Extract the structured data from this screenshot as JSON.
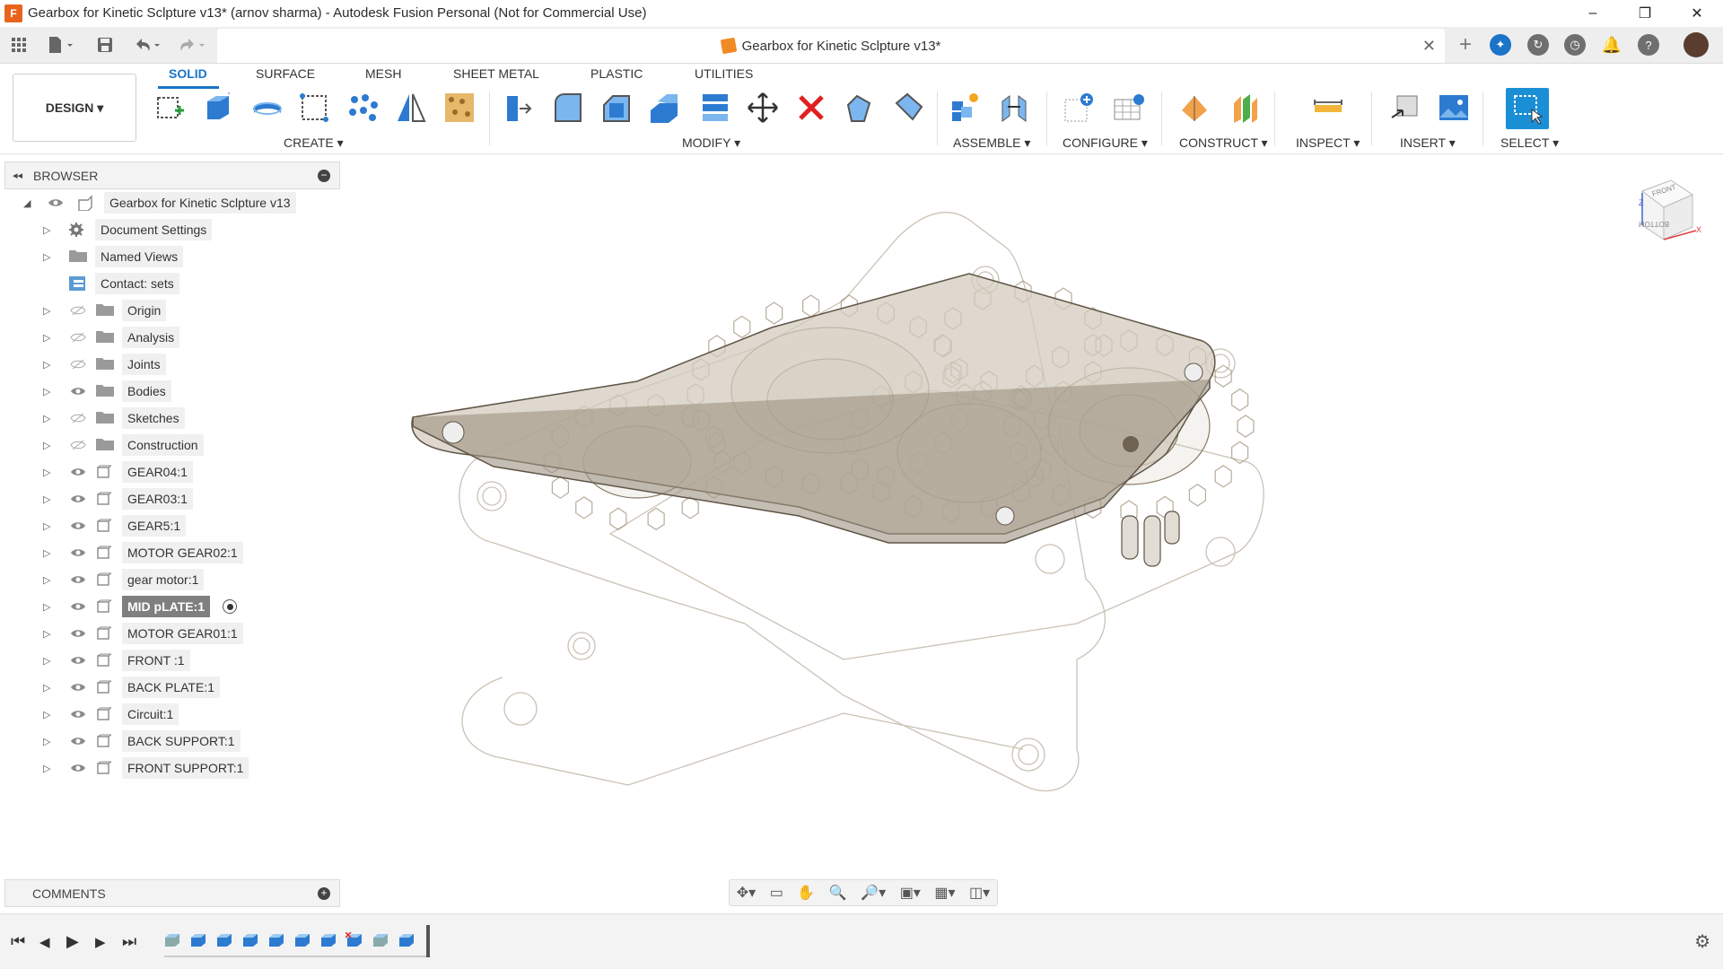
{
  "titlebar": {
    "text": "Gearbox for Kinetic Sclpture v13* (arnov sharma) - Autodesk Fusion Personal (Not for Commercial Use)",
    "app_icon": "F",
    "minimize": "–",
    "restore": "❐",
    "close": "✕"
  },
  "doc_tab": {
    "title": "Gearbox for Kinetic Sclpture v13*",
    "close": "✕"
  },
  "design_button": "DESIGN ▾",
  "tabs": [
    "SOLID",
    "SURFACE",
    "MESH",
    "SHEET METAL",
    "PLASTIC",
    "UTILITIES"
  ],
  "groups": [
    "CREATE ▾",
    "MODIFY ▾",
    "ASSEMBLE ▾",
    "CONFIGURE ▾",
    "CONSTRUCT ▾",
    "INSPECT ▾",
    "INSERT ▾",
    "SELECT ▾"
  ],
  "browser": {
    "title": "BROWSER",
    "collapse": "◂◂",
    "minus": "−"
  },
  "tree": [
    {
      "label": "Gearbox for Kinetic Sclpture v13",
      "icon": "document-icon"
    },
    {
      "label": "Document Settings",
      "icon": "gear-icon"
    },
    {
      "label": "Named Views",
      "icon": "folder-icon"
    },
    {
      "label": "Contact: sets",
      "icon": "contact-sets-icon"
    },
    {
      "label": "Origin",
      "icon": "folder-icon"
    },
    {
      "label": "Analysis",
      "icon": "folder-icon"
    },
    {
      "label": "Joints",
      "icon": "folder-icon"
    },
    {
      "label": "Bodies",
      "icon": "folder-icon"
    },
    {
      "label": "Sketches",
      "icon": "folder-icon"
    },
    {
      "label": "Construction",
      "icon": "folder-icon"
    },
    {
      "label": "GEAR04:1",
      "icon": "component-icon"
    },
    {
      "label": "GEAR03:1",
      "icon": "component-icon"
    },
    {
      "label": "GEAR5:1",
      "icon": "component-icon"
    },
    {
      "label": "MOTOR GEAR02:1",
      "icon": "component-icon"
    },
    {
      "label": "gear motor:1",
      "icon": "component-icon"
    },
    {
      "label": "MID pLATE:1",
      "icon": "component-icon",
      "selected": true
    },
    {
      "label": "MOTOR GEAR01:1",
      "icon": "component-icon"
    },
    {
      "label": "FRONT :1",
      "icon": "component-icon"
    },
    {
      "label": "BACK PLATE:1",
      "icon": "component-icon"
    },
    {
      "label": "Circuit:1",
      "icon": "component-icon"
    },
    {
      "label": "BACK SUPPORT:1",
      "icon": "component-icon"
    },
    {
      "label": "FRONT SUPPORT:1",
      "icon": "component-icon"
    }
  ],
  "viewcube": {
    "front": "FRONT",
    "bottom": "BOTTOM",
    "axis_x": "X",
    "axis_z": "Z"
  },
  "comments": {
    "title": "COMMENTS",
    "plus": "+"
  },
  "timeline": {
    "first": "⏮",
    "prev": "◀",
    "play": "▶",
    "next": "▶",
    "last": "⏭"
  },
  "colors": {
    "accent": "#1b74c8",
    "select_fill": "#1a8fd6",
    "model_edge": "#8a7a66",
    "mid_plate": "#d3cbbd"
  }
}
